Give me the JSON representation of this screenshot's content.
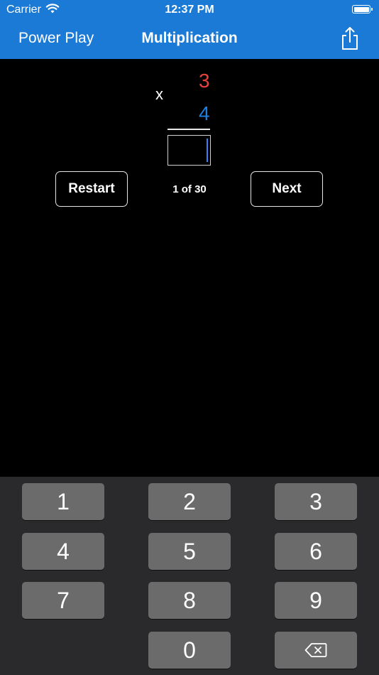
{
  "status_bar": {
    "carrier": "Carrier",
    "time": "12:37 PM"
  },
  "nav": {
    "back_label": "Power Play",
    "title": "Multiplication"
  },
  "problem": {
    "operator": "x",
    "top_number": "3",
    "bottom_number": "4",
    "answer_value": "",
    "colors": {
      "top": "#e8403a",
      "bottom": "#1e7fe0"
    }
  },
  "controls": {
    "restart_label": "Restart",
    "next_label": "Next",
    "progress": "1 of 30"
  },
  "keypad": {
    "keys": [
      "1",
      "2",
      "3",
      "4",
      "5",
      "6",
      "7",
      "8",
      "9",
      "0"
    ],
    "delete_icon": "backspace-icon"
  },
  "colors": {
    "accent": "#1a7ad6"
  }
}
